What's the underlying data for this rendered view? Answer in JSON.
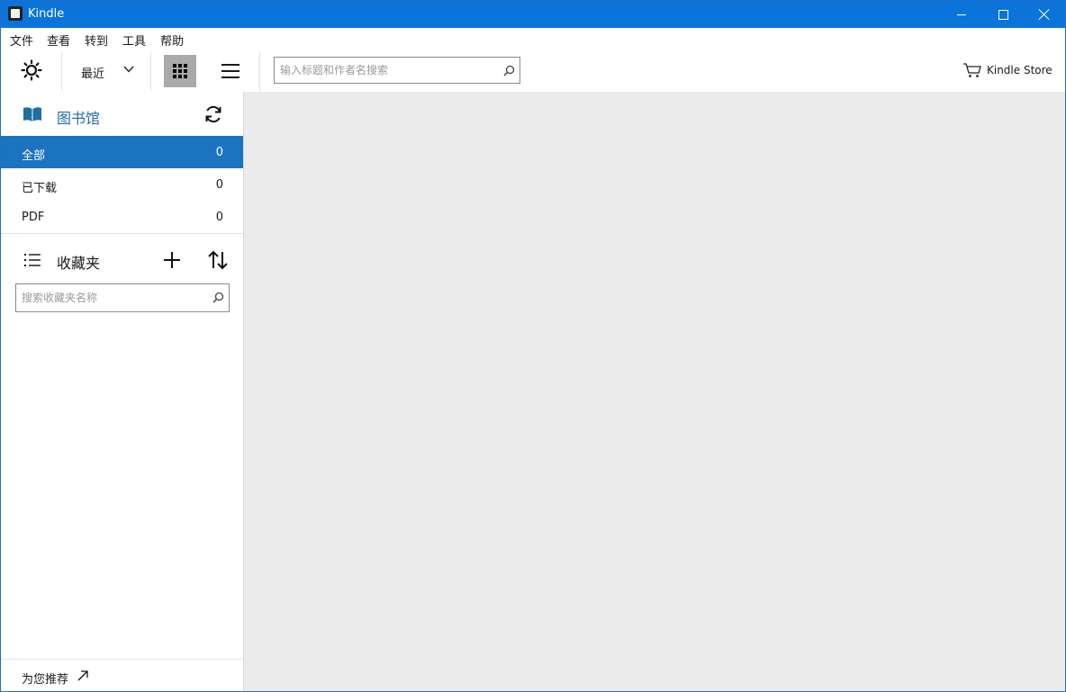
{
  "window": {
    "title": "Kindle"
  },
  "menu": [
    "文件",
    "查看",
    "转到",
    "工具",
    "帮助"
  ],
  "toolbar": {
    "sort_label": "最近",
    "search_placeholder": "输入标题和作者名搜索",
    "store_label": "Kindle Store",
    "view_mode": "grid"
  },
  "sidebar": {
    "library_title": "图书馆",
    "filters": [
      {
        "label": "全部",
        "count": "0",
        "selected": true
      },
      {
        "label": "已下载",
        "count": "0",
        "selected": false
      },
      {
        "label": "PDF",
        "count": "0",
        "selected": false
      }
    ],
    "collections_title": "收藏夹",
    "collections_search_placeholder": "搜索收藏夹名称",
    "recommend_label": "为您推荐"
  },
  "colors": {
    "titlebar": "#0a74da",
    "selected_filter": "#1c73bf",
    "library_title": "#1f6fa5",
    "main_background": "#ebebeb"
  },
  "icons": [
    "sun-icon",
    "chevron-down-icon",
    "grid-view-icon",
    "list-view-icon",
    "search-icon",
    "cart-icon",
    "book-icon",
    "sync-icon",
    "collections-list-icon",
    "plus-icon",
    "sort-updown-icon",
    "external-arrow-icon"
  ]
}
